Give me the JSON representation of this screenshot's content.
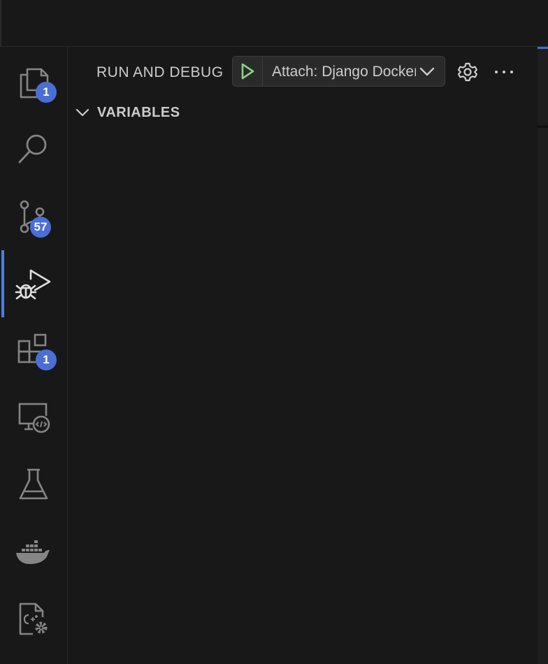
{
  "activity_bar": {
    "items": [
      {
        "name": "explorer",
        "icon": "files-icon",
        "badge": "1",
        "active": false
      },
      {
        "name": "search",
        "icon": "search-icon",
        "badge": "",
        "active": false
      },
      {
        "name": "source-control",
        "icon": "source-control-icon",
        "badge": "57",
        "active": false
      },
      {
        "name": "run-and-debug",
        "icon": "run-debug-icon",
        "badge": "",
        "active": true
      },
      {
        "name": "extensions",
        "icon": "extensions-icon",
        "badge": "1",
        "active": false
      },
      {
        "name": "remote-explorer",
        "icon": "remote-explorer-icon",
        "badge": "",
        "active": false
      },
      {
        "name": "testing",
        "icon": "flask-icon",
        "badge": "",
        "active": false
      },
      {
        "name": "docker",
        "icon": "docker-icon",
        "badge": "",
        "active": false
      },
      {
        "name": "cpp-settings",
        "icon": "cpp-config-icon",
        "badge": "",
        "active": false
      }
    ]
  },
  "sidebar": {
    "title": "RUN AND DEBUG",
    "config_select": {
      "value": "Attach: Django Docker",
      "run_icon": "play-icon",
      "dropdown_icon": "chevron-down-icon"
    },
    "actions": {
      "settings_icon": "gear-icon",
      "more_icon": "ellipsis-icon"
    },
    "sections": [
      {
        "title": "VARIABLES",
        "expanded": true,
        "chevron_icon": "chevron-down-icon"
      }
    ]
  },
  "colors": {
    "background": "#181818",
    "accent": "#4f7fd8",
    "badge": "#4b6ed6",
    "play": "#89d185",
    "icon": "#cccccc",
    "muted_icon": "#858585"
  }
}
